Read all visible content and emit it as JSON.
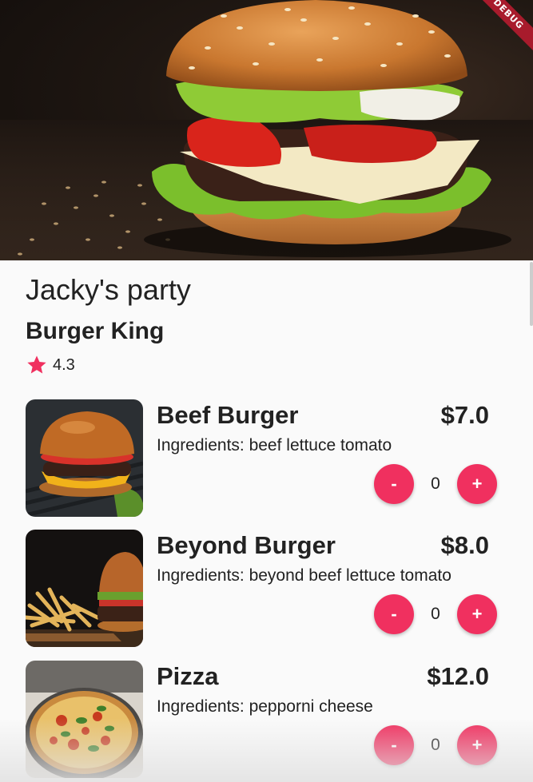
{
  "debug_banner": "DEBUG",
  "event": {
    "title": "Jacky's party"
  },
  "restaurant": {
    "name": "Burger King",
    "rating": "4.3",
    "star_color": "#f0305f"
  },
  "accent_color": "#f0305f",
  "menu": [
    {
      "name": "Beef Burger",
      "price": "$7.0",
      "ingredients": "Ingredients: beef lettuce tomato",
      "quantity": "0",
      "minus": "-",
      "plus": "+"
    },
    {
      "name": "Beyond Burger",
      "price": "$8.0",
      "ingredients": "Ingredients: beyond beef lettuce tomato",
      "quantity": "0",
      "minus": "-",
      "plus": "+"
    },
    {
      "name": "Pizza",
      "price": "$12.0",
      "ingredients": "Ingredients: pepporni cheese",
      "quantity": "0",
      "minus": "-",
      "plus": "+"
    }
  ]
}
